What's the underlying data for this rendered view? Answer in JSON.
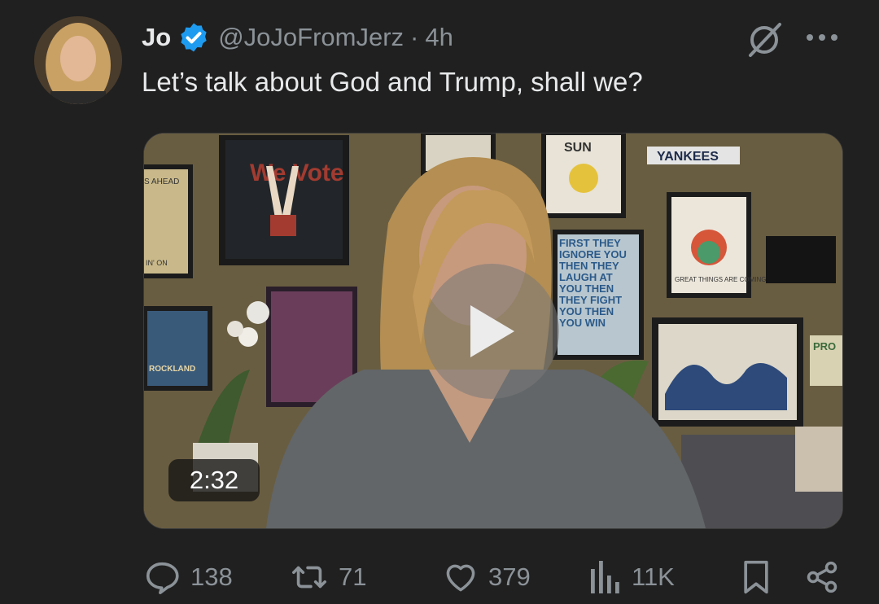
{
  "tweet": {
    "author_name": "Jo",
    "handle": "@JoJoFromJerz",
    "separator": "·",
    "time": "4h",
    "text": "Let’s talk about God and Trump, shall we?"
  },
  "media": {
    "duration": "2:32",
    "play_icon": "play-icon",
    "poster_texts": {
      "we_vote": "We Vote",
      "sun": "SUN",
      "yankees": "YANKEES",
      "first_they": "FIRST THEY IGNORE YOU THEN THEY LAUGH AT YOU THEN THEY FIGHT YOU THEN YOU WIN",
      "great_things": "GREAT THINGS ARE COMING",
      "rockland": "ROCKLAND",
      "ahead": "S AHEAD",
      "on": "IN' ON",
      "pro": "PRO"
    }
  },
  "actions": {
    "replies": "138",
    "reposts": "71",
    "likes": "379",
    "views": "11K"
  },
  "colors": {
    "background": "#202020",
    "text": "#e7e9ea",
    "muted": "#8b9298",
    "verified": "#1d9bf0"
  }
}
